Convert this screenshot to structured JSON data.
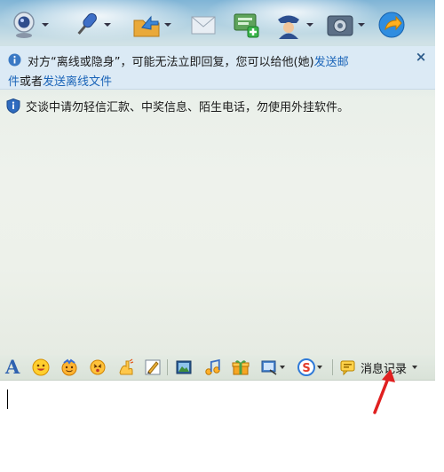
{
  "toolbar": {
    "items": [
      {
        "icon": "webcam-icon"
      },
      {
        "icon": "microphone-icon"
      },
      {
        "icon": "send-file-icon"
      },
      {
        "icon": "email-icon"
      },
      {
        "icon": "add-app-icon"
      },
      {
        "icon": "remote-assist-icon"
      },
      {
        "icon": "settings-icon"
      },
      {
        "icon": "share-icon"
      }
    ]
  },
  "notice": {
    "text_before": "对方“离线或隐身”，可能无法立即回复，您可以给他(她)",
    "link_offline_mail_part1": "发送邮",
    "link_offline_mail_part2": "件",
    "text_middle": "或者",
    "link_offline_file": "发送离线文件",
    "close": "×"
  },
  "security_tip": "交谈中请勿轻信汇款、中奖信息、陌生电话，勿使用外挂软件。",
  "format_toolbar": {
    "font_glyph": "A",
    "items": [
      "font-icon",
      "emoji-icon",
      "magic-emoji-icon",
      "shake-icon",
      "multifunction-icon",
      "doodle-icon",
      "image-icon",
      "music-icon",
      "gift-icon",
      "screenshot-icon",
      "sogou-input-icon"
    ],
    "history_label": "消息记录"
  },
  "colors": {
    "link": "#1a64b8",
    "notice_bg": "#dbeaf6",
    "annotation_arrow": "#e02020"
  }
}
